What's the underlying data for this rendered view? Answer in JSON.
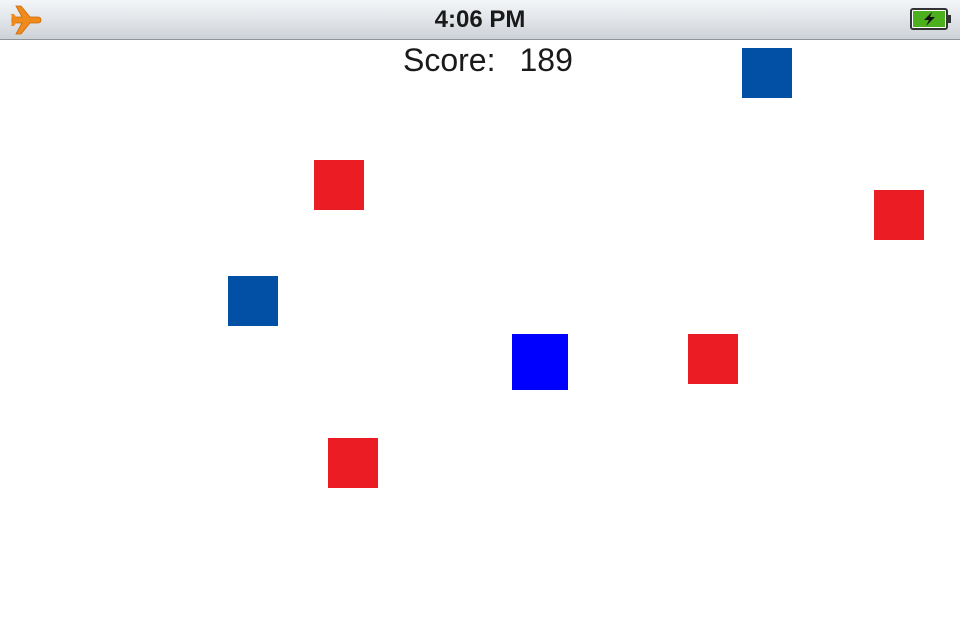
{
  "status_bar": {
    "time": "4:06 PM",
    "left_icon": "airplane-icon",
    "right_icon": "battery-charging-icon",
    "airplane_color": "#f08a1c",
    "battery_color": "#4caf1e"
  },
  "game": {
    "score_label": "Score:",
    "score_value": "189",
    "colors": {
      "hazard_red": "#ec1c24",
      "target_dark_blue": "#0250a6",
      "player_blue": "#0000ff"
    },
    "blocks": {
      "red_count": 4,
      "dark_blue_count": 2
    }
  }
}
